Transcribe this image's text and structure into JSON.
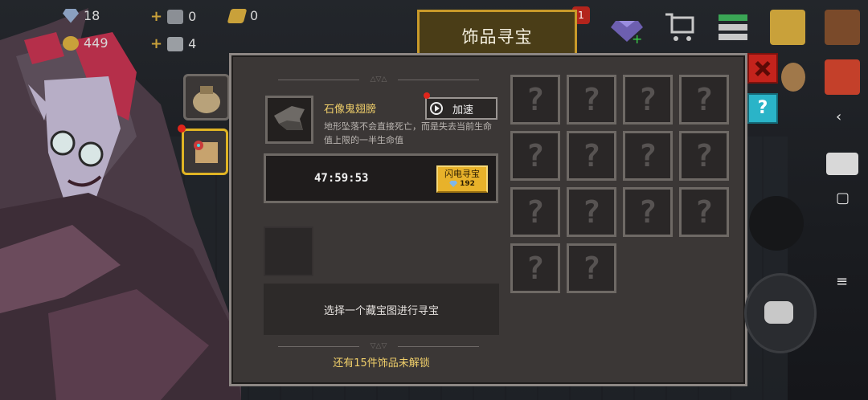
{
  "hud": {
    "gem_count": "18",
    "coin_count": "449",
    "plus_a_count": "0",
    "plus_b_count": "4",
    "material_count": "0",
    "notif_badge": "1"
  },
  "title": "饰品寻宝",
  "item": {
    "name": "石像鬼翅膀",
    "description": "地形坠落不会直接死亡，而是失去当前生命值上限的一半生命值"
  },
  "speed_button": "加速",
  "timer": "47:59:53",
  "flash_button": {
    "label": "闪电寻宝",
    "cost": "192"
  },
  "select_prompt": "选择一个藏宝图进行寻宝",
  "remaining_text": "还有15件饰品未解锁",
  "locked_slot_mark": "?",
  "help_mark": "?",
  "colors": {
    "gold": "#f0cf6a",
    "panel": "#3b3736",
    "frame": "#8d8784",
    "accent": "#c99a2a"
  },
  "icons": [
    "gem-icon",
    "shop-cart-icon",
    "coin-stack-icon",
    "treasure-chest-icon",
    "backpack-icon",
    "gift-icon",
    "chat-icon"
  ]
}
